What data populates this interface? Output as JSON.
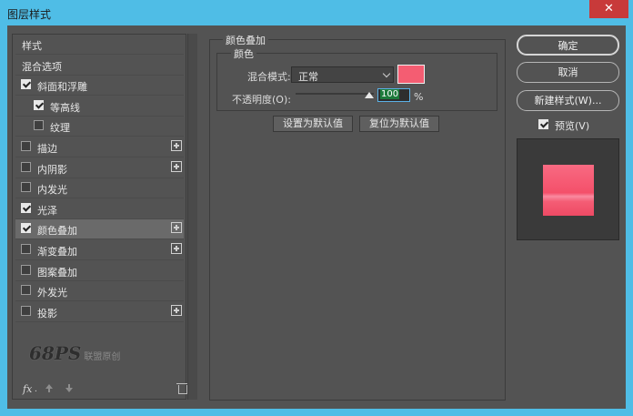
{
  "window": {
    "title": "图层样式",
    "close_icon": "close-icon"
  },
  "styles": {
    "items": [
      {
        "label": "样式",
        "checkbox": false,
        "checked": false,
        "plus": false,
        "selected": false
      },
      {
        "label": "混合选项",
        "checkbox": false,
        "checked": false,
        "plus": false,
        "selected": false
      },
      {
        "label": "斜面和浮雕",
        "checkbox": true,
        "checked": true,
        "plus": false,
        "selected": false
      },
      {
        "label": "等高线",
        "checkbox": true,
        "checked": true,
        "plus": false,
        "selected": false
      },
      {
        "label": "纹理",
        "checkbox": true,
        "checked": false,
        "plus": false,
        "selected": false
      },
      {
        "label": "描边",
        "checkbox": true,
        "checked": false,
        "plus": true,
        "selected": false
      },
      {
        "label": "内阴影",
        "checkbox": true,
        "checked": false,
        "plus": true,
        "selected": false
      },
      {
        "label": "内发光",
        "checkbox": true,
        "checked": false,
        "plus": false,
        "selected": false
      },
      {
        "label": "光泽",
        "checkbox": true,
        "checked": true,
        "plus": false,
        "selected": false
      },
      {
        "label": "颜色叠加",
        "checkbox": true,
        "checked": true,
        "plus": true,
        "selected": true
      },
      {
        "label": "渐变叠加",
        "checkbox": true,
        "checked": false,
        "plus": true,
        "selected": false
      },
      {
        "label": "图案叠加",
        "checkbox": true,
        "checked": false,
        "plus": false,
        "selected": false
      },
      {
        "label": "外发光",
        "checkbox": true,
        "checked": false,
        "plus": false,
        "selected": false
      },
      {
        "label": "投影",
        "checkbox": true,
        "checked": false,
        "plus": true,
        "selected": false
      }
    ],
    "watermark_big": "68PS",
    "watermark_small": "联盟原创",
    "fx_label": "fx"
  },
  "overlay": {
    "group_title": "颜色叠加",
    "sub_title": "颜色",
    "blend_mode_label": "混合模式:",
    "blend_mode_value": "正常",
    "color": "#f45d72",
    "opacity_label": "不透明度(O):",
    "opacity_value": "100",
    "opacity_unit": "%",
    "opacity_level": 1.0,
    "set_default_label": "设置为默认值",
    "reset_default_label": "复位为默认值"
  },
  "actions": {
    "ok_label": "确定",
    "cancel_label": "取消",
    "new_style_label": "新建样式(W)...",
    "preview_label": "预览(V)",
    "preview_checked": true
  },
  "colors": {
    "titlebar": "#4fbde6",
    "panel": "#535353",
    "overlay": "#f45d72"
  }
}
